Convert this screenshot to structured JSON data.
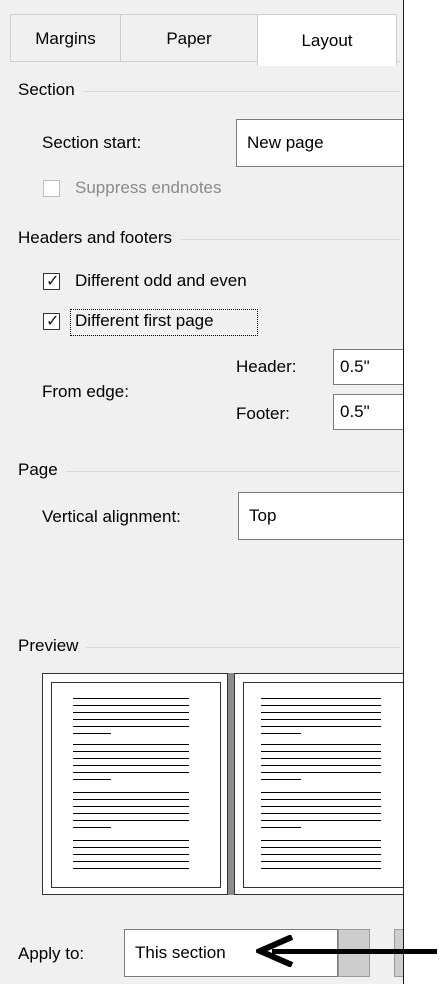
{
  "tabs": [
    {
      "label": "Margins"
    },
    {
      "label": "Paper"
    },
    {
      "label": "Layout"
    }
  ],
  "section": {
    "heading": "Section",
    "start_label": "Section start:",
    "start_value": "New page",
    "suppress_endnotes_label": "Suppress endnotes",
    "suppress_endnotes_checked": false
  },
  "headers_footers": {
    "heading": "Headers and footers",
    "odd_even_label": "Different odd and even",
    "odd_even_checked": true,
    "first_page_label": "Different first page",
    "first_page_checked": true,
    "from_edge_label": "From edge:",
    "header_label": "Header:",
    "header_value": "0.5\"",
    "footer_label": "Footer:",
    "footer_value": "0.5\""
  },
  "page": {
    "heading": "Page",
    "valign_label": "Vertical alignment:",
    "valign_value": "Top"
  },
  "preview": {
    "heading": "Preview"
  },
  "apply": {
    "label": "Apply to:",
    "value": "This section"
  },
  "colors": {
    "panel_bg": "#f0f0f0",
    "tab_active_bg": "#ffffff",
    "annotation_arrow": "#000000"
  }
}
